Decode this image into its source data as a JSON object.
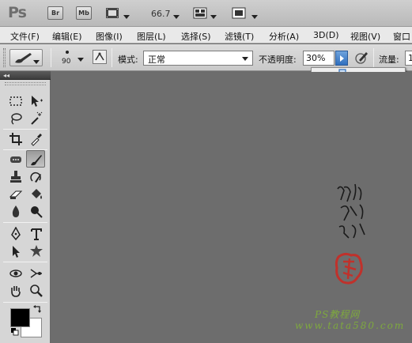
{
  "appbar": {
    "logo": "Ps",
    "bridge_label": "Br",
    "minibridge_label": "Mb",
    "zoom": "66.7"
  },
  "menu": {
    "items": [
      "文件(F)",
      "编辑(E)",
      "图像(I)",
      "图层(L)",
      "选择(S)",
      "滤镜(T)",
      "分析(A)",
      "3D(D)",
      "视图(V)",
      "窗口"
    ]
  },
  "options": {
    "brush_size": "90",
    "mode_label": "模式:",
    "mode_value": "正常",
    "opacity_label": "不透明度:",
    "opacity_value": "30%",
    "flow_label": "流量:",
    "flow_value": "1"
  },
  "opacity_slider": {
    "level": 0.3
  },
  "colors": {
    "foreground": "#000000",
    "background": "#ffffff",
    "accent": "#2f6fbf",
    "canvas": "#6d6d6d"
  },
  "toolbox": {
    "collapse_glyph": "◂◂",
    "tools": [
      "rect-marquee-icon",
      "move-icon",
      "lasso-icon",
      "magic-wand-icon",
      "crop-icon",
      "eyedropper-icon",
      "healing-brush-icon",
      "brush-icon",
      "clone-stamp-icon",
      "history-brush-icon",
      "eraser-icon",
      "paint-bucket-icon",
      "blur-icon",
      "dodge-icon",
      "pen-icon",
      "type-icon",
      "path-select-icon",
      "custom-shape-icon",
      "3d-rotate-icon",
      "3d-orbit-icon",
      "hand-icon",
      "zoom-icon"
    ]
  },
  "watermark": {
    "site": "PS教程网",
    "url": "www.tata580.com"
  }
}
